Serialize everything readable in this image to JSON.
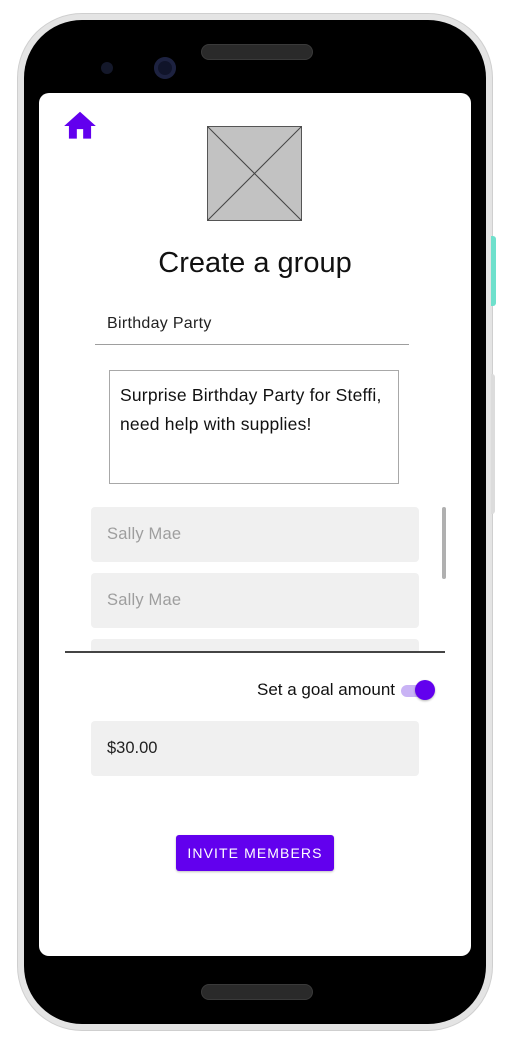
{
  "header": {
    "home_icon": "home-icon",
    "image_placeholder": "image-placeholder-icon"
  },
  "title": "Create a group",
  "group_name": {
    "value": "Birthday Party"
  },
  "description": {
    "value": "Surprise Birthday Party for Steffi, need help with supplies!"
  },
  "members": [
    {
      "name": "Sally Mae"
    },
    {
      "name": "Sally Mae"
    },
    {
      "name": ""
    }
  ],
  "goal": {
    "label": "Set a goal amount",
    "enabled": true,
    "amount": "$30.00"
  },
  "invite_button": {
    "label": "INVITE MEMBERS"
  },
  "colors": {
    "accent": "#6200ee",
    "field_bg": "#f0f0f0",
    "toggle_track": "#c9b3f5"
  }
}
